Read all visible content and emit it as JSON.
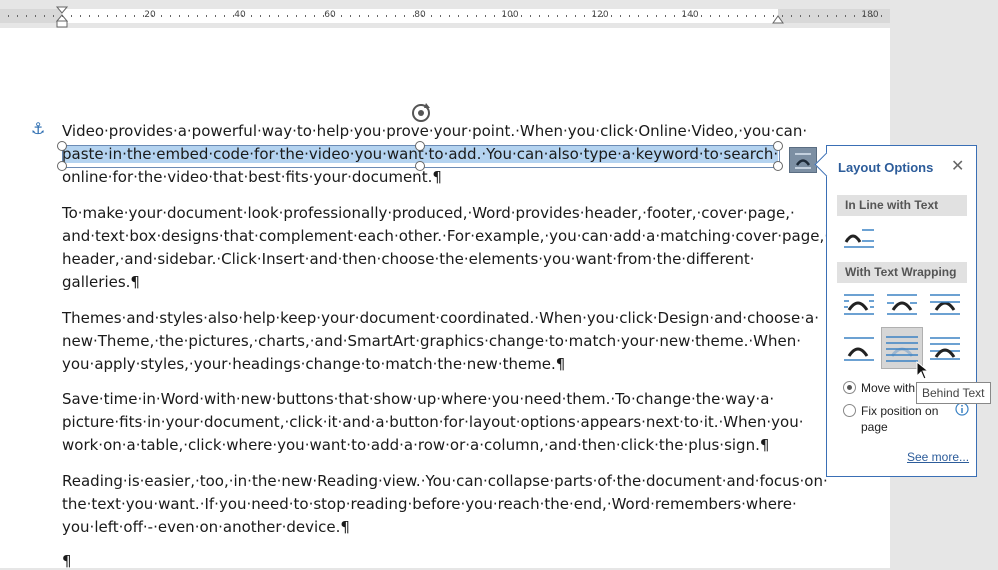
{
  "ruler": {
    "labels": [
      "20",
      "40",
      "60",
      "80",
      "100",
      "120",
      "140",
      "180"
    ]
  },
  "document": {
    "paragraphs": [
      {
        "lines": [
          "Video·provides·a·powerful·way·to·help·you·prove·your·point.·When·you·click·Online·Video,·you·can·",
          "paste·in·the·embed·code·for·the·video·you·want·to·add.·You·can·also·type·a·keyword·to·search·",
          "online·for·the·video·that·best·fits·your·document.¶"
        ]
      },
      {
        "lines": [
          "To·make·your·document·look·professionally·produced,·Word·provides·header,·footer,·cover·page,·",
          "and·text·box·designs·that·complement·each·other.·For·example,·you·can·add·a·matching·cover·page,·",
          "header,·and·sidebar.·Click·Insert·and·then·choose·the·elements·you·want·from·the·different·",
          "galleries.¶"
        ]
      },
      {
        "lines": [
          "Themes·and·styles·also·help·keep·your·document·coordinated.·When·you·click·Design·and·choose·a·",
          "new·Theme,·the·pictures,·charts,·and·SmartArt·graphics·change·to·match·your·new·theme.·When·",
          "you·apply·styles,·your·headings·change·to·match·the·new·theme.¶"
        ]
      },
      {
        "lines": [
          "Save·time·in·Word·with·new·buttons·that·show·up·where·you·need·them.·To·change·the·way·a·",
          "picture·fits·in·your·document,·click·it·and·a·button·for·layout·options·appears·next·to·it.·When·you·",
          "work·on·a·table,·click·where·you·want·to·add·a·row·or·a·column,·and·then·click·the·plus·sign.¶"
        ]
      },
      {
        "lines": [
          "Reading·is·easier,·too,·in·the·new·Reading·view.·You·can·collapse·parts·of·the·document·and·focus·on·",
          "the·text·you·want.·If·you·need·to·stop·reading·before·you·reach·the·end,·Word·remembers·where·",
          "you·left·off·-·even·on·another·device.¶"
        ]
      }
    ],
    "empty_para": "¶"
  },
  "layout_panel": {
    "title": "Layout Options",
    "close": "✕",
    "inline_header": "In Line with Text",
    "wrapping_header": "With Text Wrapping",
    "move_with_text": "Move with text",
    "fix_position": "Fix position on page",
    "see_more": "See more...",
    "selected_option": "Behind Text"
  },
  "tooltip": "Behind Text",
  "colors": {
    "accent": "#2c5c9a",
    "selection": "#b4d3f0",
    "icon_blue": "#3b82c4"
  }
}
